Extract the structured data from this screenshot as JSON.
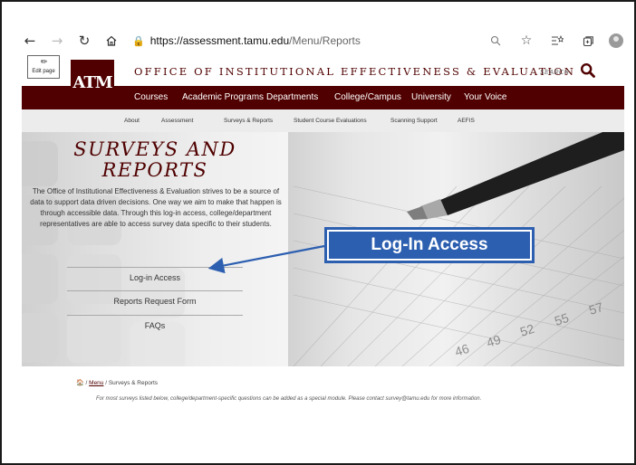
{
  "browser": {
    "url_host": "https://assessment.tamu.edu",
    "url_path": "/Menu/Reports",
    "icons": [
      "back-arrow-icon",
      "forward-arrow-icon",
      "refresh-icon",
      "home-icon",
      "lock-icon",
      "zoom-icon",
      "favorite-icon",
      "favorites-list-icon",
      "collections-icon",
      "profile-icon"
    ]
  },
  "header": {
    "edit_page": "Edit page",
    "logo_text": "ATM",
    "office_title": "OFFICE OF INSTITUTIONAL EFFECTIVENESS & EVALUATION",
    "search_label": "SEARCH"
  },
  "main_nav": [
    "Courses",
    "Academic Programs",
    "Departments",
    "College/Campus",
    "University",
    "Your Voice"
  ],
  "sub_nav": [
    "About",
    "Assessment",
    "Surveys & Reports",
    "Student Course Evaluations",
    "Scanning Support",
    "AEFIS"
  ],
  "hero": {
    "title_line1": "SURVEYS AND",
    "title_line2": "REPORTS",
    "description": "The Office of Institutional Effectiveness & Evaluation strives to be a source of data to support data driven decisions. One way we aim to make that happen is through accessible data. Through this log-in access, college/department representatives are able to access survey data specific to their students.",
    "links": [
      "Log-in Access",
      "Reports Request Form",
      "FAQs"
    ],
    "callout": "Log-In Access"
  },
  "breadcrumb": {
    "menu": "Menu",
    "current": "/ Surveys & Reports"
  },
  "note": "For most surveys listed below, college/department-specific questions can be added as a special module. Please contact survey@tamu.edu for more information.",
  "colors": {
    "maroon": "#500000",
    "callout_blue": "#2d5fb0"
  }
}
